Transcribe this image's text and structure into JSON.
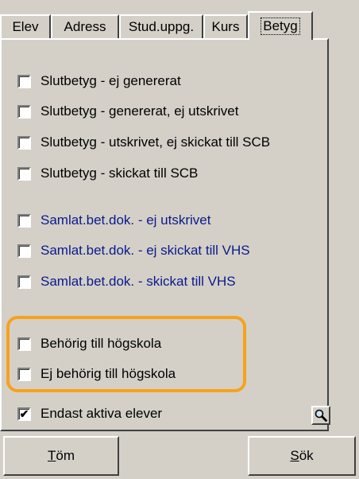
{
  "tabs": [
    {
      "label": "Elev"
    },
    {
      "label": "Adress"
    },
    {
      "label": "Stud.uppg."
    },
    {
      "label": "Kurs"
    },
    {
      "label": "Betyg",
      "active": true
    }
  ],
  "checkboxes": [
    {
      "label": "Slutbetyg - ej genererat",
      "checked": false,
      "color": "#000000"
    },
    {
      "label": "Slutbetyg - genererat, ej utskrivet",
      "checked": false,
      "color": "#000000"
    },
    {
      "label": "Slutbetyg - utskrivet, ej skickat till SCB",
      "checked": false,
      "color": "#000000"
    },
    {
      "label": "Slutbetyg - skickat till SCB",
      "checked": false,
      "color": "#000000"
    },
    {
      "label": "Samlat.bet.dok. - ej utskrivet",
      "checked": false,
      "color": "#0a1a8c"
    },
    {
      "label": "Samlat.bet.dok. - ej skickat till VHS",
      "checked": false,
      "color": "#0a1a8c"
    },
    {
      "label": "Samlat.bet.dok. - skickat till VHS",
      "checked": false,
      "color": "#0a1a8c"
    },
    {
      "label": "Behörig till högskola",
      "checked": false,
      "color": "#000000"
    },
    {
      "label": "Ej behörig till högskola",
      "checked": false,
      "color": "#000000"
    },
    {
      "label": "Endast aktiva elever",
      "checked": true,
      "color": "#000000"
    }
  ],
  "highlight_color": "#f7a21b",
  "buttons": {
    "clear": {
      "mnemonic": "T",
      "rest": "öm"
    },
    "search": {
      "mnemonic": "S",
      "rest": "ök"
    }
  },
  "icons": {
    "search": "magnifier-icon"
  }
}
